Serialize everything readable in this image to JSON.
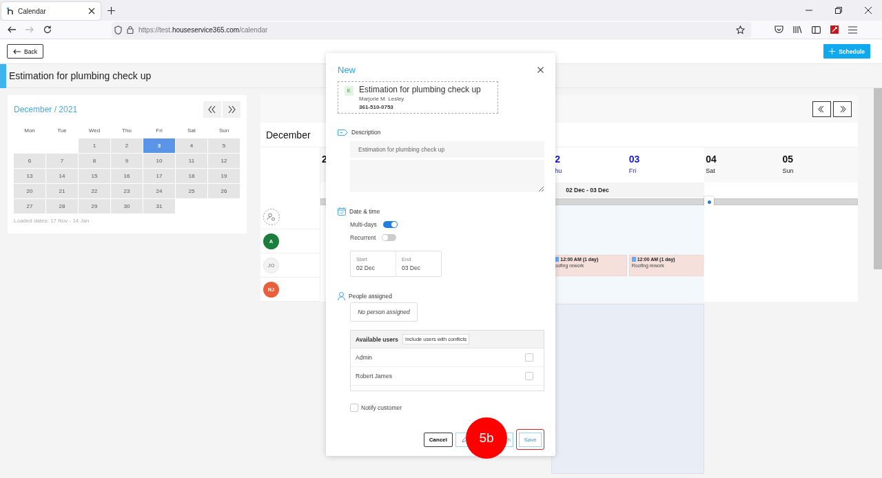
{
  "browser": {
    "tab_title": "Calendar",
    "url_parts": [
      {
        "text": "https://test.",
        "emphasis": false
      },
      {
        "text": "houseservice365.com",
        "emphasis": true
      },
      {
        "text": "/calendar",
        "emphasis": false
      }
    ]
  },
  "toolbar": {
    "back_button": "Back",
    "schedule_button": "Schedule"
  },
  "page_title": "Estimation for plumbing check up",
  "mini_calendar": {
    "title": "December / 2021",
    "weekdays": [
      "Mon",
      "Tue",
      "Wed",
      "Thu",
      "Fri",
      "Sat",
      "Sun"
    ],
    "weeks": [
      [
        {
          "kind": "blank"
        },
        {
          "kind": "blank"
        },
        {
          "day": "1",
          "selected": false
        },
        {
          "day": "2",
          "selected": false
        },
        {
          "day": "3",
          "selected": true
        },
        {
          "day": "4",
          "selected": false
        },
        {
          "day": "5",
          "selected": false
        }
      ],
      [
        {
          "day": "6",
          "selected": false
        },
        {
          "day": "7",
          "selected": false
        },
        {
          "day": "8",
          "selected": false
        },
        {
          "day": "9",
          "selected": false
        },
        {
          "day": "10",
          "selected": false
        },
        {
          "day": "11",
          "selected": false
        },
        {
          "day": "12",
          "selected": false
        }
      ],
      [
        {
          "day": "13",
          "selected": false
        },
        {
          "day": "14",
          "selected": false
        },
        {
          "day": "15",
          "selected": false
        },
        {
          "day": "16",
          "selected": false
        },
        {
          "day": "17",
          "selected": false
        },
        {
          "day": "18",
          "selected": false
        },
        {
          "day": "19",
          "selected": false
        }
      ],
      [
        {
          "day": "20",
          "selected": false
        },
        {
          "day": "21",
          "selected": false
        },
        {
          "day": "22",
          "selected": false
        },
        {
          "day": "23",
          "selected": false
        },
        {
          "day": "24",
          "selected": false
        },
        {
          "day": "25",
          "selected": false
        },
        {
          "day": "26",
          "selected": false
        }
      ],
      [
        {
          "day": "27",
          "selected": false
        },
        {
          "day": "28",
          "selected": false
        },
        {
          "day": "29",
          "selected": false
        },
        {
          "day": "30",
          "selected": false
        },
        {
          "day": "31",
          "selected": false
        }
      ]
    ],
    "note": "Loaded dates: 17 Nov - 14 Jan"
  },
  "week_view": {
    "month": "December",
    "days": [
      {
        "date": "2",
        "in_range": false
      },
      {
        "date": "2",
        "weekday": "hu",
        "in_range": true
      },
      {
        "date": "03",
        "weekday": "Fri",
        "in_range": true
      },
      {
        "date": "04",
        "weekday": "Sat",
        "in_range": false
      },
      {
        "date": "05",
        "weekday": "Sun",
        "in_range": false
      }
    ],
    "range_label": "02 Dec - 03 Dec",
    "people": [
      {
        "kind": "unassigned"
      },
      {
        "kind": "avatar",
        "initials": "A",
        "color": "#1a7f3c",
        "disabled": false
      },
      {
        "kind": "avatar",
        "initials": "JO",
        "disabled": true
      },
      {
        "kind": "avatar",
        "initials": "RJ",
        "color": "#e8603c",
        "disabled": false
      }
    ],
    "events": [
      {
        "time": "12:00 AM (1 day)",
        "title": "oofing rework"
      },
      {
        "time": "12:00 AM (1 day)",
        "title": "Roofing rework"
      }
    ]
  },
  "modal": {
    "title": "New",
    "job": {
      "badge": "E",
      "title": "Estimation for plumbing check up",
      "customer": "Marjorie M. Lesley",
      "phone": "361-510-0753"
    },
    "description_label": "Description",
    "description_value": "Estimation for plumbing check up",
    "date_label": "Date & time",
    "toggles": [
      {
        "label": "Multi-days",
        "on": true
      },
      {
        "label": "Recurrent",
        "on": false
      }
    ],
    "start": {
      "label": "Start",
      "value": "02 Dec"
    },
    "end": {
      "label": "End",
      "value": "03 Dec"
    },
    "people_label": "People assigned",
    "assigned": "No person assigned",
    "available_label": "Available users",
    "conflicts_button": "Include users with conflicts",
    "users": [
      {
        "name": "Admin",
        "checked": false
      },
      {
        "name": "Robert James",
        "checked": false
      }
    ],
    "notify": {
      "label": "Notify customer",
      "checked": false
    },
    "buttons": {
      "cancel": "Cancel",
      "middle": "h",
      "save": "Save"
    }
  },
  "annotation": {
    "label": "5b"
  }
}
